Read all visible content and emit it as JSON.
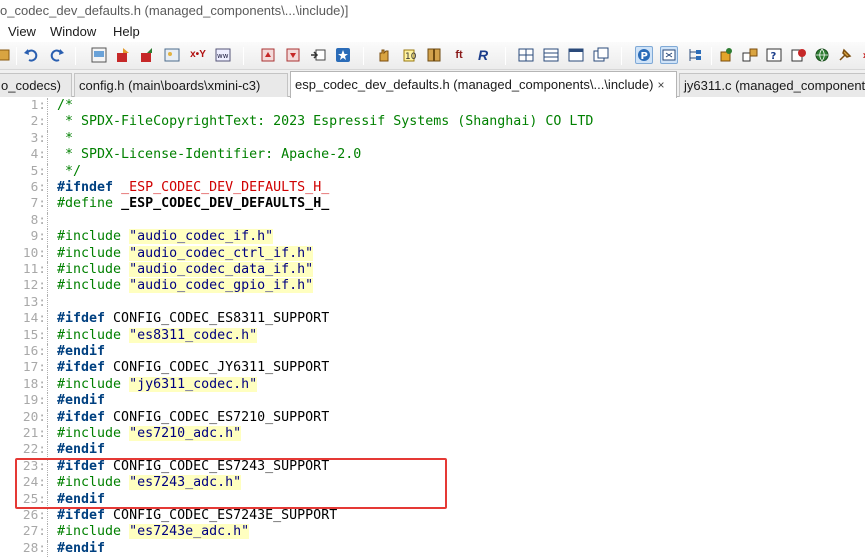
{
  "window": {
    "title": "o_codec_dev_defaults.h (managed_components\\...\\include)]"
  },
  "menu": [
    "View",
    "Window",
    "Help"
  ],
  "toolbar": {
    "icons": [
      "unknown-icon",
      "undo-icon",
      "redo-icon",
      "view-icon",
      "export-icon",
      "import-icon",
      "image-icon",
      "xy-icon",
      "hex-icon",
      "bookmark-up-icon",
      "bookmark-down-icon",
      "goto-icon",
      "star-icon",
      "hand-icon",
      "tag-icon",
      "book-icon",
      "font-icon",
      "regex-icon",
      "grid-icon",
      "list-icon",
      "window-icon",
      "windows-icon",
      "p-icon",
      "toggle-icon",
      "tree-icon",
      "puzzle-icon",
      "shapes-icon",
      "help-icon",
      "stamp-icon",
      "globe-icon",
      "pin-icon"
    ]
  },
  "tabs": [
    {
      "label": "o_codecs)",
      "active": false
    },
    {
      "label": "config.h (main\\boards\\xmini-c3)",
      "active": false
    },
    {
      "label": "esp_codec_dev_defaults.h (managed_components\\...\\include)",
      "active": true,
      "close": "×"
    },
    {
      "label": "jy6311.c (managed_component",
      "active": false
    }
  ],
  "code_lines": [
    {
      "n": "1:",
      "parts": [
        [
          "cmt",
          "/*"
        ]
      ]
    },
    {
      "n": "2:",
      "parts": [
        [
          "cmt",
          " * SPDX-FileCopyrightText: 2023 Espressif Systems (Shanghai) CO LTD"
        ]
      ]
    },
    {
      "n": "3:",
      "parts": [
        [
          "cmt",
          " *"
        ]
      ]
    },
    {
      "n": "4:",
      "parts": [
        [
          "cmt",
          " * SPDX-License-Identifier: Apache-2.0"
        ]
      ]
    },
    {
      "n": "5:",
      "parts": [
        [
          "cmt",
          " */"
        ]
      ]
    },
    {
      "n": "6:",
      "parts": [
        [
          "pp",
          "#ifndef"
        ],
        [
          "plain",
          " "
        ],
        [
          "macro-red",
          "_ESP_CODEC_DEV_DEFAULTS_H_"
        ]
      ]
    },
    {
      "n": "7:",
      "parts": [
        [
          "ppg",
          "#define"
        ],
        [
          "plain",
          " "
        ],
        [
          "macro-bold",
          "_ESP_CODEC_DEV_DEFAULTS_H_"
        ]
      ]
    },
    {
      "n": "8:",
      "parts": []
    },
    {
      "n": "9:",
      "parts": [
        [
          "ppg",
          "#include"
        ],
        [
          "plain",
          " "
        ],
        [
          "str",
          "\"audio_codec_if.h\""
        ]
      ]
    },
    {
      "n": "10:",
      "parts": [
        [
          "ppg",
          "#include"
        ],
        [
          "plain",
          " "
        ],
        [
          "str",
          "\"audio_codec_ctrl_if.h\""
        ]
      ]
    },
    {
      "n": "11:",
      "parts": [
        [
          "ppg",
          "#include"
        ],
        [
          "plain",
          " "
        ],
        [
          "str",
          "\"audio_codec_data_if.h\""
        ]
      ]
    },
    {
      "n": "12:",
      "parts": [
        [
          "ppg",
          "#include"
        ],
        [
          "plain",
          " "
        ],
        [
          "str",
          "\"audio_codec_gpio_if.h\""
        ]
      ]
    },
    {
      "n": "13:",
      "parts": []
    },
    {
      "n": "14:",
      "parts": [
        [
          "pp",
          "#ifdef"
        ],
        [
          "plain",
          " CONFIG_CODEC_ES8311_SUPPORT"
        ]
      ]
    },
    {
      "n": "15:",
      "parts": [
        [
          "ppg",
          "#include"
        ],
        [
          "plain",
          " "
        ],
        [
          "str",
          "\"es8311_codec.h\""
        ]
      ]
    },
    {
      "n": "16:",
      "parts": [
        [
          "pp",
          "#endif"
        ]
      ]
    },
    {
      "n": "17:",
      "parts": [
        [
          "pp",
          "#ifdef"
        ],
        [
          "plain",
          " CONFIG_CODEC_JY6311_SUPPORT"
        ]
      ]
    },
    {
      "n": "18:",
      "parts": [
        [
          "ppg",
          "#include"
        ],
        [
          "plain",
          " "
        ],
        [
          "str",
          "\"jy6311_codec.h\""
        ]
      ]
    },
    {
      "n": "19:",
      "parts": [
        [
          "pp",
          "#endif"
        ]
      ]
    },
    {
      "n": "20:",
      "parts": [
        [
          "pp",
          "#ifdef"
        ],
        [
          "plain",
          " CONFIG_CODEC_ES7210_SUPPORT"
        ]
      ]
    },
    {
      "n": "21:",
      "parts": [
        [
          "ppg",
          "#include"
        ],
        [
          "plain",
          " "
        ],
        [
          "str",
          "\"es7210_adc.h\""
        ]
      ]
    },
    {
      "n": "22:",
      "parts": [
        [
          "pp",
          "#endif"
        ]
      ]
    },
    {
      "n": "23:",
      "parts": [
        [
          "pp",
          "#ifdef"
        ],
        [
          "plain",
          " CONFIG_CODEC_ES7243_SUPPORT"
        ]
      ]
    },
    {
      "n": "24:",
      "parts": [
        [
          "ppg",
          "#include"
        ],
        [
          "plain",
          " "
        ],
        [
          "str",
          "\"es7243_adc.h\""
        ]
      ]
    },
    {
      "n": "25:",
      "parts": [
        [
          "pp",
          "#endif"
        ]
      ]
    },
    {
      "n": "26:",
      "parts": [
        [
          "pp",
          "#ifdef"
        ],
        [
          "plain",
          " CONFIG_CODEC_ES7243E_SUPPORT"
        ]
      ]
    },
    {
      "n": "27:",
      "parts": [
        [
          "ppg",
          "#include"
        ],
        [
          "plain",
          " "
        ],
        [
          "str",
          "\"es7243e_adc.h\""
        ]
      ]
    },
    {
      "n": "28:",
      "parts": [
        [
          "pp",
          "#endif"
        ]
      ]
    }
  ],
  "colors": {
    "comment": "#008000",
    "preprocessor": "#004080",
    "string_bg": "#ffffc0",
    "highlight_box": "#e53935"
  }
}
